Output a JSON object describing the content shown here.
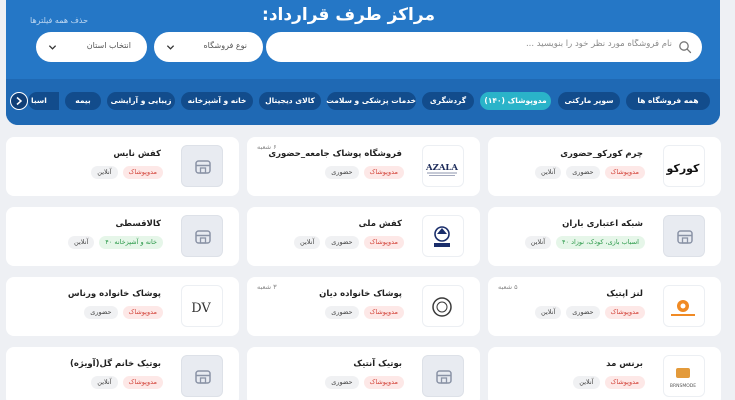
{
  "header": {
    "title": "مراکز طرف قرارداد:",
    "clear_filters": "حذف همه فیلترها",
    "search_placeholder": "نام فروشگاه مورد نظر خود را بنویسید ...",
    "store_type_label": "نوع فروشگاه",
    "province_label": "انتخاب استان"
  },
  "categories": [
    {
      "label": "همه فروشگاه ها",
      "active": false
    },
    {
      "label": "سوپر مارکتی",
      "active": false
    },
    {
      "label": "مدوپوشاک (۱۴۰)",
      "active": true
    },
    {
      "label": "گردشگری",
      "active": false
    },
    {
      "label": "خدمات پزشکی و سلامت",
      "active": false
    },
    {
      "label": "کالای دیجیتال",
      "active": false
    },
    {
      "label": "خانه و آشپزخانه",
      "active": false
    },
    {
      "label": "زیبایی و آرایشی",
      "active": false
    },
    {
      "label": "بیمه",
      "active": false
    },
    {
      "label": "اسبا",
      "active": false
    }
  ],
  "stores": [
    {
      "name": "چرم کورکو_حضوری",
      "tags": [
        {
          "text": "مدوپوشاک",
          "color": "red"
        },
        {
          "text": "حضوری",
          "color": "gray"
        },
        {
          "text": "آنلاین",
          "color": "gray"
        }
      ],
      "branch": "",
      "logo": "korko"
    },
    {
      "name": "فروشگاه پوشاک جامعه_حضوری",
      "tags": [
        {
          "text": "مدوپوشاک",
          "color": "red"
        },
        {
          "text": "حضوری",
          "color": "gray"
        }
      ],
      "branch": "۶ شعبه",
      "logo": "azala"
    },
    {
      "name": "کفش نایس",
      "tags": [
        {
          "text": "مدوپوشاک",
          "color": "red"
        },
        {
          "text": "آنلاین",
          "color": "gray"
        }
      ],
      "branch": "",
      "logo": "placeholder"
    },
    {
      "name": "شبکه اعتباری باران",
      "tags": [
        {
          "text": "اسباب بازی، کودک، نوزاد ۴۰",
          "color": "green"
        },
        {
          "text": "آنلاین",
          "color": "gray"
        }
      ],
      "branch": "",
      "logo": "placeholder"
    },
    {
      "name": "کفش ملی",
      "tags": [
        {
          "text": "مدوپوشاک",
          "color": "red"
        },
        {
          "text": "حضوری",
          "color": "gray"
        },
        {
          "text": "آنلاین",
          "color": "gray"
        }
      ],
      "branch": "",
      "logo": "melli"
    },
    {
      "name": "کالاقسطی",
      "tags": [
        {
          "text": "خانه و آشپزخانه ۴۰",
          "color": "green"
        },
        {
          "text": "آنلاین",
          "color": "gray"
        }
      ],
      "branch": "",
      "logo": "placeholder"
    },
    {
      "name": "لنز اپتیک",
      "tags": [
        {
          "text": "مدوپوشاک",
          "color": "red"
        },
        {
          "text": "حضوری",
          "color": "gray"
        },
        {
          "text": "آنلاین",
          "color": "gray"
        }
      ],
      "branch": "۵ شعبه",
      "logo": "lenz"
    },
    {
      "name": "پوشاک خانواده دیان",
      "tags": [
        {
          "text": "مدوپوشاک",
          "color": "red"
        },
        {
          "text": "حضوری",
          "color": "gray"
        }
      ],
      "branch": "۳ شعبه",
      "logo": "dian"
    },
    {
      "name": "پوشاک خانواده ورناس",
      "tags": [
        {
          "text": "مدوپوشاک",
          "color": "red"
        },
        {
          "text": "حضوری",
          "color": "gray"
        }
      ],
      "branch": "",
      "logo": "dv"
    },
    {
      "name": "برنس مد",
      "tags": [
        {
          "text": "مدوپوشاک",
          "color": "red"
        },
        {
          "text": "آنلاین",
          "color": "gray"
        }
      ],
      "branch": "",
      "logo": "brns"
    },
    {
      "name": "بوتیک آنتیک",
      "tags": [
        {
          "text": "مدوپوشاک",
          "color": "red"
        },
        {
          "text": "حضوری",
          "color": "gray"
        }
      ],
      "branch": "",
      "logo": "placeholder"
    },
    {
      "name": "بوتیک خانم گل(آویژه)",
      "tags": [
        {
          "text": "مدوپوشاک",
          "color": "red"
        },
        {
          "text": "آنلاین",
          "color": "gray"
        }
      ],
      "branch": "",
      "logo": "placeholder"
    }
  ],
  "logo_text": {
    "korko": "کورکو",
    "azala": "AZALA",
    "dv": "DV",
    "brns": "BRNSMODE"
  },
  "colors": {
    "header_blue": "#2577c6",
    "band_blue": "#1f69b4",
    "chip_dark": "#124c8c",
    "chip_active": "#2ab3c9",
    "tag_red": "#d3453b",
    "tag_green": "#2d9a4b"
  }
}
